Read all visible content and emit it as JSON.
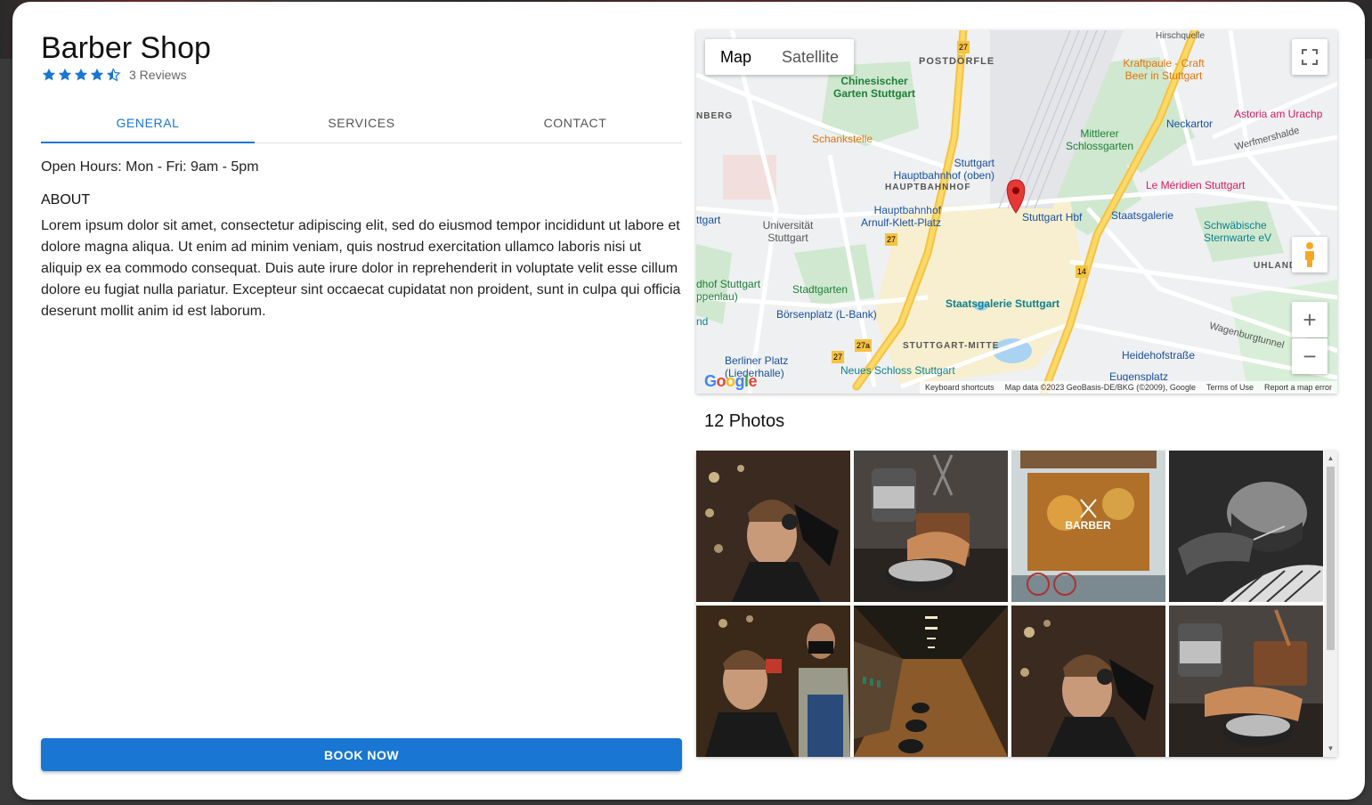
{
  "shop": {
    "title": "Barber Shop",
    "rating": 4.5,
    "reviews_label": "3 Reviews"
  },
  "tabs": [
    {
      "label": "GENERAL",
      "active": true
    },
    {
      "label": "SERVICES",
      "active": false
    },
    {
      "label": "CONTACT",
      "active": false
    }
  ],
  "general": {
    "hours": "Open Hours: Mon - Fri: 9am - 5pm",
    "about_heading": "ABOUT",
    "about_text": "Lorem ipsum dolor sit amet, consectetur adipiscing elit, sed do eiusmod tempor incididunt ut labore et dolore magna aliqua. Ut enim ad minim veniam, quis nostrud exercitation ullamco laboris nisi ut aliquip ex ea commodo consequat. Duis aute irure dolor in reprehenderit in voluptate velit esse cillum dolore eu fugiat nulla pariatur. Excepteur sint occaecat cupidatat non proident, sunt in culpa qui officia deserunt mollit anim id est laborum."
  },
  "book_button": "BOOK NOW",
  "map": {
    "type_map": "Map",
    "type_satellite": "Satellite",
    "zoom_in": "+",
    "zoom_out": "−",
    "google": "Google",
    "attribution": {
      "shortcuts": "Keyboard shortcuts",
      "data": "Map data ©2023 GeoBasis-DE/BKG (©2009), Google",
      "terms": "Terms of Use",
      "report": "Report a map error"
    },
    "labels": {
      "postdorfle": "POSTDÖRFLE",
      "chinesischer": "Chinesischer Garten Stuttgart",
      "schankstelle": "Schankstelle",
      "hauptbahnhof_oben": "Stuttgart Hauptbahnhof (oben)",
      "hauptbahnhof_dist": "HAUPTBAHNHOF",
      "arnulf": "Hauptbahnhof Arnulf-Klett-Platz",
      "hbf": "Stuttgart Hbf",
      "staatsgalerie_stop": "Staatsgalerie",
      "universitat": "Universität Stuttgart",
      "stadtgarten": "Stadtgarten",
      "borsenplatz": "Börsenplatz (L-Bank)",
      "staatsgalerie": "Staatsgalerie Stuttgart",
      "stuttgart_mitte": "STUTTGART-MITTE",
      "neues_schloss": "Neues Schloss Stuttgart",
      "berliner_platz": "Berliner Platz (Liederhalle)",
      "kraftpaule": "Kraftpaule - Craft Beer in Stuttgart",
      "neckartor": "Neckartor",
      "astoria": "Astoria am Urachp",
      "mittlerer": "Mittlerer Schlossgarten",
      "meridien": "Le Méridien Stuttgart",
      "schwabische": "Schwäbische Sternwarte eV",
      "uhlandshohe": "UHLANDSHÖH",
      "wagenburg": "Wagenburgtunnel",
      "heidehof": "Heidehofstraße",
      "eugensplatz": "Eugensplatz",
      "werfmershalde": "Werfmershalde",
      "hirschquelle": "Hirschquelle",
      "nberg": "NBERG",
      "ttgart": "ttgart",
      "dhof": "dhof Stuttgart",
      "ppenlau": "ppenlau)",
      "nd": "nd",
      "route27": "27",
      "route14": "14",
      "route27a": "27a"
    }
  },
  "photos": {
    "heading": "12 Photos",
    "items": [
      {
        "name": "barber-cutting-hair-photo"
      },
      {
        "name": "pomade-and-comb-photo"
      },
      {
        "name": "barber-storefront-photo"
      },
      {
        "name": "beard-trim-bw-photo"
      },
      {
        "name": "barber-with-mask-photo"
      },
      {
        "name": "barber-shop-interior-photo"
      },
      {
        "name": "barber-cutting-hair-2-photo"
      },
      {
        "name": "pomade-and-comb-2-photo"
      }
    ]
  },
  "colors": {
    "primary": "#1976d2",
    "star": "#1976d2",
    "map_road_major": "#f7c843",
    "map_park": "#c8e6c9",
    "map_pin": "#e53935"
  }
}
